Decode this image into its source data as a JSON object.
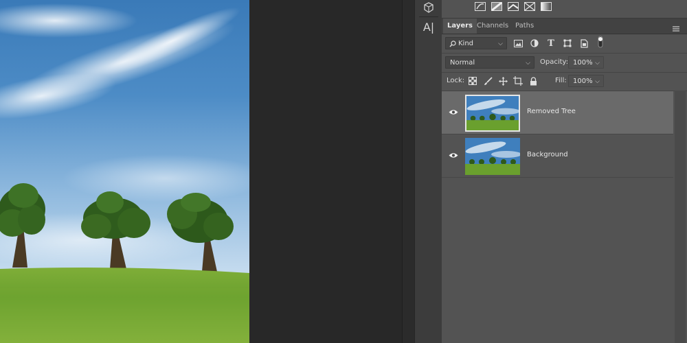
{
  "colors": {
    "panel_bg": "#535353",
    "tabbar_bg": "#424242",
    "selected_layer_bg": "#6a6a6a",
    "pasteboard": "#282828",
    "sky_top": "#2a6fb0",
    "grass": "#6aa02e"
  },
  "toolbar": {
    "icons": [
      "3d-object-icon",
      "character-panel-icon"
    ],
    "character_label": "A|"
  },
  "adjustments": {
    "icons": [
      "gradient-map-icon",
      "posterize-icon",
      "threshold-icon",
      "selective-color-icon",
      "gradient-fill-icon"
    ]
  },
  "tabs": [
    {
      "label": "Layers",
      "active": true
    },
    {
      "label": "Channels",
      "active": false
    },
    {
      "label": "Paths",
      "active": false
    }
  ],
  "filter": {
    "kind_label": "Kind",
    "icons": [
      "pixel-filter-icon",
      "adjustment-filter-icon",
      "type-filter-icon",
      "shape-filter-icon",
      "smart-object-filter-icon",
      "filter-toggle-icon"
    ]
  },
  "blend": {
    "mode": "Normal",
    "opacity_label": "Opacity:",
    "opacity_value": "100%"
  },
  "lock": {
    "label": "Lock:",
    "icons": [
      "lock-transparent-pixels-icon",
      "lock-image-pixels-icon",
      "lock-position-icon",
      "lock-artboard-icon",
      "lock-all-icon"
    ],
    "fill_label": "Fill:",
    "fill_value": "100%"
  },
  "layers": [
    {
      "name": "Removed Tree",
      "visible": true,
      "selected": true
    },
    {
      "name": "Background",
      "visible": true,
      "selected": false
    }
  ]
}
